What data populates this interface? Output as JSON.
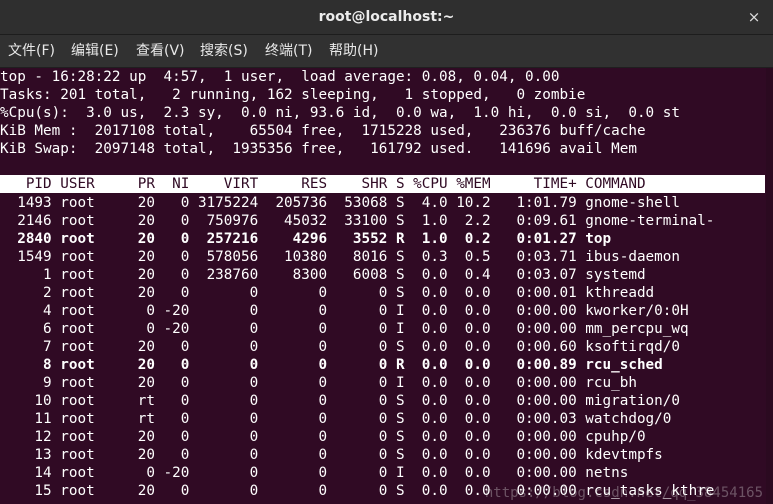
{
  "window": {
    "title": "root@localhost:~",
    "close_glyph": "×"
  },
  "menu": [
    {
      "label": "文件(F)"
    },
    {
      "label": "编辑(E)"
    },
    {
      "label": "查看(V)"
    },
    {
      "label": "搜索(S)"
    },
    {
      "label": "终端(T)"
    },
    {
      "label": "帮助(H)"
    }
  ],
  "summary": [
    "top - 16:28:22 up  4:57,  1 user,  load average: 0.08, 0.04, 0.00",
    "Tasks: 201 total,   2 running, 162 sleeping,   1 stopped,   0 zombie",
    "%Cpu(s):  3.0 us,  2.3 sy,  0.0 ni, 93.6 id,  0.0 wa,  1.0 hi,  0.0 si,  0.0 st",
    "KiB Mem :  2017108 total,    65504 free,  1715228 used,   236376 buff/cache",
    "KiB Swap:  2097148 total,  1935356 free,   161792 used.   141696 avail Mem"
  ],
  "columns": [
    "PID",
    "USER",
    "PR",
    "NI",
    "VIRT",
    "RES",
    "SHR",
    "S",
    "%CPU",
    "%MEM",
    "TIME+",
    "COMMAND"
  ],
  "processes": [
    {
      "pid": "1493",
      "user": "root",
      "pr": "20",
      "ni": "0",
      "virt": "3175224",
      "res": "205736",
      "shr": "53068",
      "s": "S",
      "cpu": "4.0",
      "mem": "10.2",
      "time": "1:01.79",
      "cmd": "gnome-shell",
      "bold": false
    },
    {
      "pid": "2146",
      "user": "root",
      "pr": "20",
      "ni": "0",
      "virt": "750976",
      "res": "45032",
      "shr": "33100",
      "s": "S",
      "cpu": "1.0",
      "mem": "2.2",
      "time": "0:09.61",
      "cmd": "gnome-terminal-",
      "bold": false
    },
    {
      "pid": "2840",
      "user": "root",
      "pr": "20",
      "ni": "0",
      "virt": "257216",
      "res": "4296",
      "shr": "3552",
      "s": "R",
      "cpu": "1.0",
      "mem": "0.2",
      "time": "0:01.27",
      "cmd": "top",
      "bold": true
    },
    {
      "pid": "1549",
      "user": "root",
      "pr": "20",
      "ni": "0",
      "virt": "578056",
      "res": "10380",
      "shr": "8016",
      "s": "S",
      "cpu": "0.3",
      "mem": "0.5",
      "time": "0:03.71",
      "cmd": "ibus-daemon",
      "bold": false
    },
    {
      "pid": "1",
      "user": "root",
      "pr": "20",
      "ni": "0",
      "virt": "238760",
      "res": "8300",
      "shr": "6008",
      "s": "S",
      "cpu": "0.0",
      "mem": "0.4",
      "time": "0:03.07",
      "cmd": "systemd",
      "bold": false
    },
    {
      "pid": "2",
      "user": "root",
      "pr": "20",
      "ni": "0",
      "virt": "0",
      "res": "0",
      "shr": "0",
      "s": "S",
      "cpu": "0.0",
      "mem": "0.0",
      "time": "0:00.01",
      "cmd": "kthreadd",
      "bold": false
    },
    {
      "pid": "4",
      "user": "root",
      "pr": "0",
      "ni": "-20",
      "virt": "0",
      "res": "0",
      "shr": "0",
      "s": "I",
      "cpu": "0.0",
      "mem": "0.0",
      "time": "0:00.00",
      "cmd": "kworker/0:0H",
      "bold": false
    },
    {
      "pid": "6",
      "user": "root",
      "pr": "0",
      "ni": "-20",
      "virt": "0",
      "res": "0",
      "shr": "0",
      "s": "I",
      "cpu": "0.0",
      "mem": "0.0",
      "time": "0:00.00",
      "cmd": "mm_percpu_wq",
      "bold": false
    },
    {
      "pid": "7",
      "user": "root",
      "pr": "20",
      "ni": "0",
      "virt": "0",
      "res": "0",
      "shr": "0",
      "s": "S",
      "cpu": "0.0",
      "mem": "0.0",
      "time": "0:00.60",
      "cmd": "ksoftirqd/0",
      "bold": false
    },
    {
      "pid": "8",
      "user": "root",
      "pr": "20",
      "ni": "0",
      "virt": "0",
      "res": "0",
      "shr": "0",
      "s": "R",
      "cpu": "0.0",
      "mem": "0.0",
      "time": "0:00.89",
      "cmd": "rcu_sched",
      "bold": true
    },
    {
      "pid": "9",
      "user": "root",
      "pr": "20",
      "ni": "0",
      "virt": "0",
      "res": "0",
      "shr": "0",
      "s": "I",
      "cpu": "0.0",
      "mem": "0.0",
      "time": "0:00.00",
      "cmd": "rcu_bh",
      "bold": false
    },
    {
      "pid": "10",
      "user": "root",
      "pr": "rt",
      "ni": "0",
      "virt": "0",
      "res": "0",
      "shr": "0",
      "s": "S",
      "cpu": "0.0",
      "mem": "0.0",
      "time": "0:00.00",
      "cmd": "migration/0",
      "bold": false
    },
    {
      "pid": "11",
      "user": "root",
      "pr": "rt",
      "ni": "0",
      "virt": "0",
      "res": "0",
      "shr": "0",
      "s": "S",
      "cpu": "0.0",
      "mem": "0.0",
      "time": "0:00.03",
      "cmd": "watchdog/0",
      "bold": false
    },
    {
      "pid": "12",
      "user": "root",
      "pr": "20",
      "ni": "0",
      "virt": "0",
      "res": "0",
      "shr": "0",
      "s": "S",
      "cpu": "0.0",
      "mem": "0.0",
      "time": "0:00.00",
      "cmd": "cpuhp/0",
      "bold": false
    },
    {
      "pid": "13",
      "user": "root",
      "pr": "20",
      "ni": "0",
      "virt": "0",
      "res": "0",
      "shr": "0",
      "s": "S",
      "cpu": "0.0",
      "mem": "0.0",
      "time": "0:00.00",
      "cmd": "kdevtmpfs",
      "bold": false
    },
    {
      "pid": "14",
      "user": "root",
      "pr": "0",
      "ni": "-20",
      "virt": "0",
      "res": "0",
      "shr": "0",
      "s": "I",
      "cpu": "0.0",
      "mem": "0.0",
      "time": "0:00.00",
      "cmd": "netns",
      "bold": false
    },
    {
      "pid": "15",
      "user": "root",
      "pr": "20",
      "ni": "0",
      "virt": "0",
      "res": "0",
      "shr": "0",
      "s": "S",
      "cpu": "0.0",
      "mem": "0.0",
      "time": "0:00.00",
      "cmd": "rcu_tasks_kthre",
      "bold": false
    }
  ],
  "watermark": "https://blog.csdn.net/qq_38454165",
  "colors": {
    "terminal_bg": "#300a24",
    "text": "#ffffff",
    "header_bg": "#ffffff",
    "titlebar_bg": "#2f2f2f"
  }
}
